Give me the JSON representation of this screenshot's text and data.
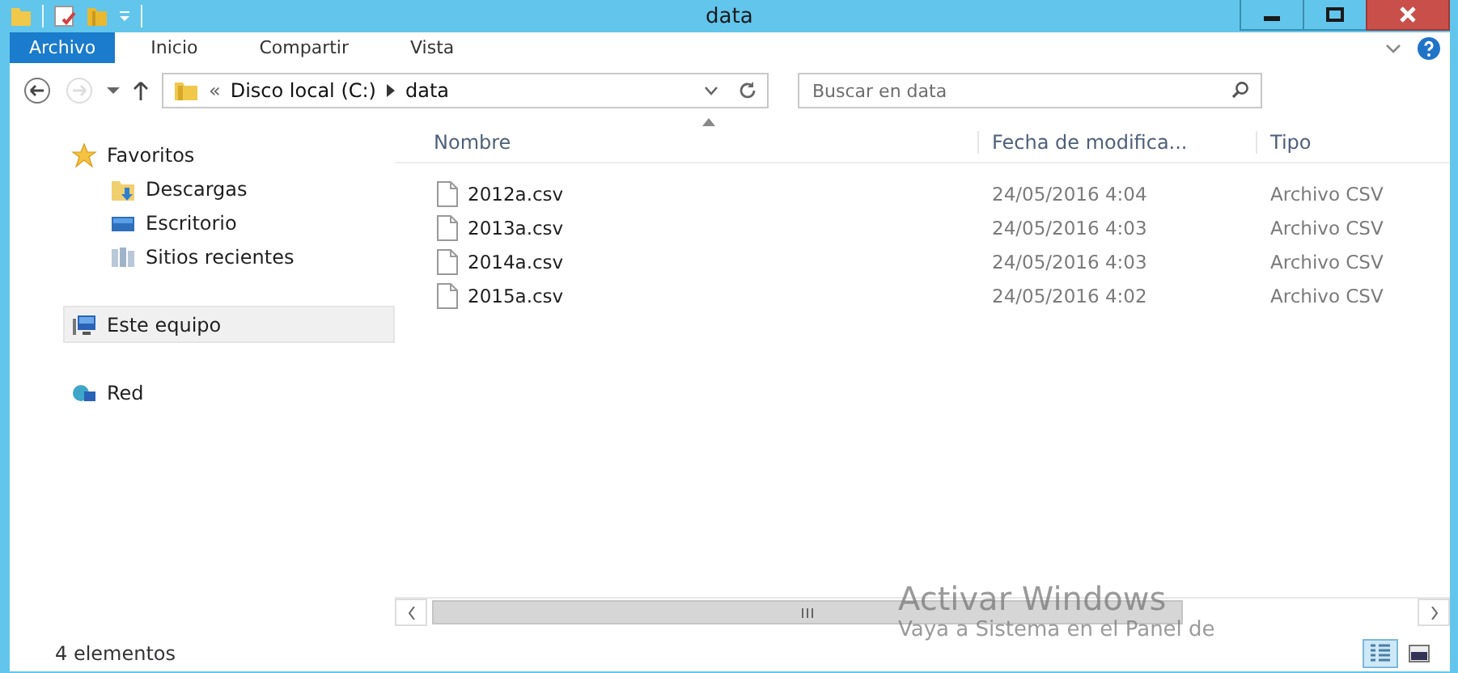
{
  "window": {
    "title": "data"
  },
  "ribbon": {
    "tabs": [
      {
        "label": "Archivo",
        "kind": "file"
      },
      {
        "label": "Inicio",
        "kind": "tab"
      },
      {
        "label": "Compartir",
        "kind": "tab"
      },
      {
        "label": "Vista",
        "kind": "tab"
      }
    ]
  },
  "address_bar": {
    "overflow_mark": "«",
    "path": [
      "Disco local (C:)",
      "data"
    ]
  },
  "search": {
    "placeholder": "Buscar en data"
  },
  "navigation": [
    {
      "label": "Favoritos",
      "kind": "star",
      "selected": false,
      "children": [
        {
          "label": "Descargas",
          "kind": "downloads",
          "selected": false
        },
        {
          "label": "Escritorio",
          "kind": "desktop",
          "selected": false
        },
        {
          "label": "Sitios recientes",
          "kind": "recent",
          "selected": false
        }
      ]
    },
    {
      "label": "Este equipo",
      "kind": "computer",
      "selected": true
    },
    {
      "label": "Red",
      "kind": "network",
      "selected": false
    }
  ],
  "file_list": {
    "columns": [
      "Nombre",
      "Fecha de modifica...",
      "Tipo"
    ],
    "rows": [
      {
        "name": "2012a.csv",
        "date": "24/05/2016 4:04",
        "type": "Archivo CSV"
      },
      {
        "name": "2013a.csv",
        "date": "24/05/2016 4:03",
        "type": "Archivo CSV"
      },
      {
        "name": "2014a.csv",
        "date": "24/05/2016 4:03",
        "type": "Archivo CSV"
      },
      {
        "name": "2015a.csv",
        "date": "24/05/2016 4:02",
        "type": "Archivo CSV"
      }
    ]
  },
  "status_bar": {
    "text": "4 elementos",
    "views": [
      {
        "kind": "details",
        "selected": true
      },
      {
        "kind": "large",
        "selected": false
      }
    ]
  },
  "activation_notice": {
    "title": "Activar Windows",
    "text": "Vaya a Sistema en el Panel de"
  }
}
